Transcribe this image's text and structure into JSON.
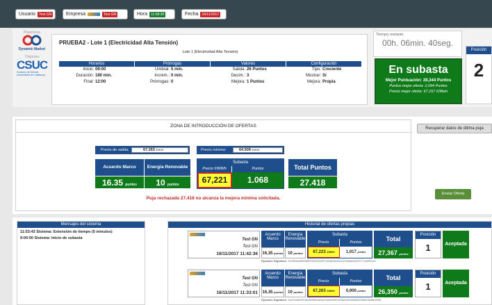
{
  "topbar": {
    "usuario_label": "Usuario",
    "usuario_value": "Test GN",
    "empresa_label": "Empresa",
    "empresa_value": "Test GN",
    "hora_label": "Hora",
    "hora_value": "11:58:30",
    "fecha_label": "Fecha",
    "fecha_value": "16/11/2017"
  },
  "header": {
    "plataforma_label": "Plataforma",
    "plataforma_name": "Dynamic Market",
    "organiza_label": "Organiza",
    "organiza_name": "CSUC",
    "organiza_sub": "Consorci de Serveis Universitaris de Catalunya",
    "title": "PRUEBA2 - Lote 1 (Electricidad Alta Tensión)",
    "subtitle": "Lote 1 (Electricidad Alta Tensión)",
    "sections": [
      {
        "title": "Horarios",
        "lines": [
          [
            "Inicio:",
            "09:00"
          ],
          [
            "Duración:",
            "180 min."
          ],
          [
            "Final:",
            "12:00"
          ]
        ]
      },
      {
        "title": "Prórrogas",
        "lines": [
          [
            "Umbral:",
            "5 min."
          ],
          [
            "Increm.:",
            "0 min."
          ],
          [
            "Prórrogas:",
            "0"
          ]
        ]
      },
      {
        "title": "Valores",
        "lines": [
          [
            "Salida:",
            "26 Puntos"
          ],
          [
            "Decim.:",
            "3"
          ],
          [
            "Mejora:",
            "1 Puntos"
          ]
        ]
      },
      {
        "title": "Configuración",
        "lines": [
          [
            "Tipo:",
            "Creciente"
          ],
          [
            "Mostrar:",
            "Sí"
          ],
          [
            "Mejora:",
            "Propia"
          ]
        ]
      }
    ],
    "time_label": "Tiempo restante",
    "time_value": "00h. 06min. 40seg.",
    "status": "En subasta",
    "mejor_puntuacion": "Mejor Puntuación: 28,344 Puntos",
    "puntos_mejor": "Puntos mejor oferta: 2,694 Puntos",
    "precio_mejor": "Precio mejor oferta: 67,157 €/Mwh",
    "posicion_label": "Posición",
    "posicion_value": "2"
  },
  "offer": {
    "zone_title": "ZONA DE INTRODUCCIÓN DE OFERTAS",
    "recuperar_btn": "Recuperar datos de última puja",
    "precio_salida_label": "Precio de salida:",
    "precio_salida_value": "67.263",
    "precio_salida_unit": "€/MWh",
    "precio_minimo_label": "Precio mínimo:",
    "precio_minimo_value": "64.509",
    "precio_minimo_unit": "€/MWh",
    "acuerdo_label": "Acuerdo Marco",
    "acuerdo_value": "16.35",
    "acuerdo_unit": "puntos",
    "energia_label": "Energía Renovable",
    "energia_value": "10",
    "energia_unit": "puntos",
    "subasta_label": "Subasta",
    "precio_col": "Precio €/MWh",
    "puntos_col": "Puntos",
    "precio_input": "67,221",
    "puntos_value": "1.068",
    "total_label": "Total Puntos",
    "total_value": "27.418",
    "error_msg": "Puja rechazada 27,418 no alcanza la mejora mínima solicitada.",
    "enviar_btn": "Enviar Oferta"
  },
  "messages": {
    "title": "Mensajes del sistema",
    "items": [
      "11:53:43 Sistema: Extensión de tiempo (5 minutos)",
      "9:00:00 Sistema: Inicio de subasta"
    ]
  },
  "history": {
    "title": "Historial de ofertas propias",
    "headers": {
      "acuerdo": "Acuerdo Marco",
      "energia": "Energía Renovable",
      "subasta": "Subasta",
      "precio": "Precio",
      "puntos": "Puntos",
      "total": "Total",
      "posicion": "Posición"
    },
    "rows": [
      {
        "company": "Test GN",
        "user": "Test GN",
        "datetime": "16/11/2017 11:42:36",
        "acuerdo": "16,35",
        "acuerdo_unit": "puntos",
        "energia": "10",
        "energia_unit": "puntos",
        "precio": "67,223",
        "precio_unit": "€/MWh",
        "puntos": "1,017",
        "puntos_unit": "puntos",
        "total": "27,367",
        "total_unit": "puntos",
        "posicion": "1",
        "estado": "Aceptada",
        "signature_label": "Dynamic Signature:",
        "signature": "0c1855ca0f6b83f20f29c5b49722e8bfa4a52cc108ab04f570774cb95cd1"
      },
      {
        "company": "Test GN",
        "user": "Test GN",
        "datetime": "16/11/2017 11:33:01",
        "acuerdo": "16,35",
        "acuerdo_unit": "puntos",
        "energia": "10",
        "energia_unit": "puntos",
        "precio": "67,263",
        "precio_unit": "€/MWh",
        "puntos": "0,000",
        "puntos_unit": "puntos",
        "total": "26,350",
        "total_unit": "puntos",
        "posicion": "1",
        "estado": "Aceptada",
        "signature_label": "Dynamic Signature:",
        "signature": "ece7ba6259c3f18990bda0cb23a54b5f2340ae94049f8d2820e8c36dfbd09f6"
      }
    ]
  },
  "colors": {
    "accent_blue": "#1f4e8c",
    "accent_green": "#0f7a1a",
    "error_red": "#c62828",
    "highlight_yellow": "#ffff33"
  }
}
